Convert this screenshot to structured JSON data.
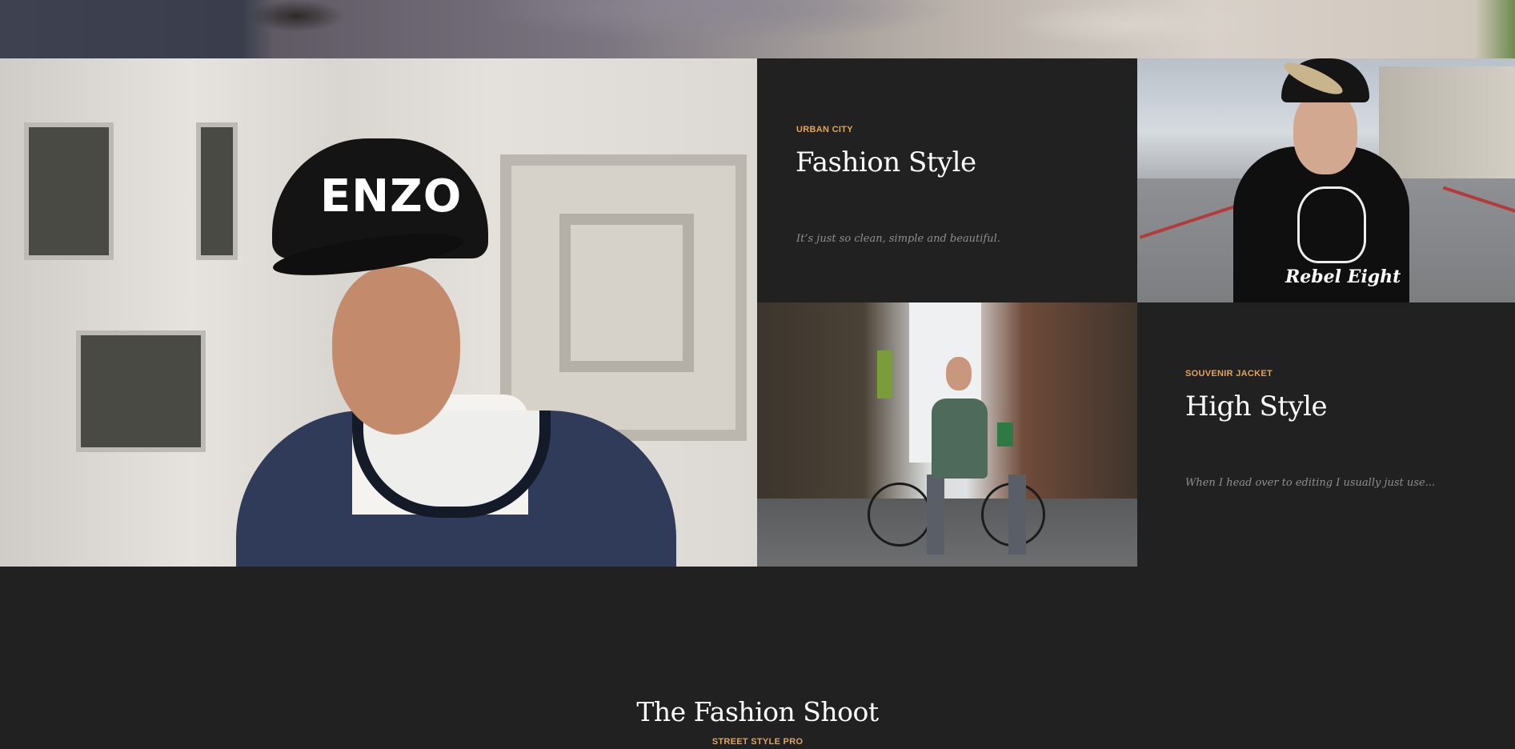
{
  "cards": [
    {
      "kicker": "URBAN CITY",
      "title": "Fashion Style",
      "description": "It’s just so clean, simple and beautiful."
    },
    {
      "kicker": "SOUVENIR JACKET",
      "title": "High Style",
      "description": "When I head over to editing I usually just use..."
    }
  ],
  "photos": {
    "main_cap_text": "ENZO",
    "rebel_shirt_text": "Rebel Eight"
  },
  "section": {
    "title": "The Fashion Shoot",
    "kicker": "STREET STYLE PRO"
  },
  "colors": {
    "background": "#212121",
    "accent": "#e0a45f",
    "title_text": "#ffffff",
    "description_text": "#8f8f8f"
  }
}
